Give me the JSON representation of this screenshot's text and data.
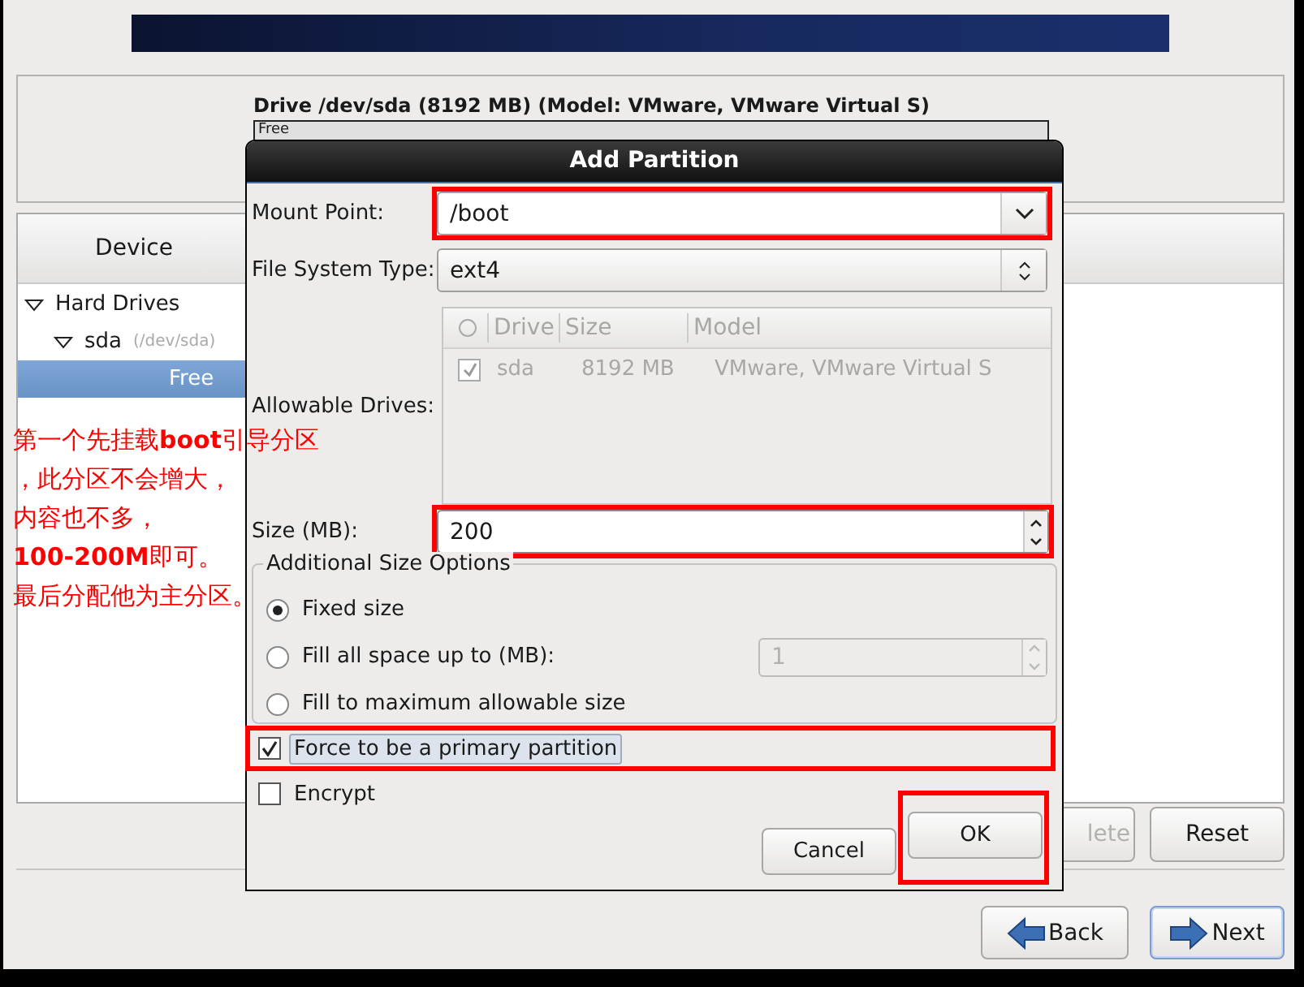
{
  "drive_panel": {
    "title": "Drive /dev/sda (8192 MB) (Model: VMware, VMware Virtual S)",
    "bar_segments": [
      {
        "label": "Free"
      }
    ]
  },
  "device_list": {
    "columns": [
      "Device"
    ],
    "tree": [
      {
        "label": "Hard Drives",
        "expanded": true,
        "selected": false,
        "children": [
          {
            "label": "sda",
            "detail": "(/dev/sda)",
            "expanded": true,
            "selected": false,
            "children": [
              {
                "label": "Free",
                "selected": true
              }
            ]
          }
        ]
      }
    ]
  },
  "panel_buttons": [
    {
      "label": "lete",
      "disabled": true
    },
    {
      "label": "Reset",
      "disabled": false
    }
  ],
  "nav_buttons": [
    {
      "label": "Back",
      "kind": "back",
      "default": false
    },
    {
      "label": "Next",
      "kind": "next",
      "default": true
    }
  ],
  "dialog": {
    "title": "Add Partition",
    "mount_point": {
      "label": "Mount Point:",
      "value": "/boot",
      "highlighted": true
    },
    "file_system_type": {
      "label": "File System Type:",
      "value": "ext4"
    },
    "allowable_drives": {
      "label": "Allowable Drives:",
      "disabled": true,
      "columns": [
        "Drive",
        "Size",
        "Model"
      ],
      "rows": [
        {
          "checked": true,
          "cells": [
            "sda",
            "8192 MB",
            "VMware, VMware Virtual S"
          ]
        }
      ]
    },
    "size": {
      "label": "Size (MB):",
      "value": "200",
      "highlighted": true
    },
    "size_options": {
      "title": "Additional Size Options",
      "options": [
        {
          "label": "Fixed size",
          "selected": true
        },
        {
          "label": "Fill all space up to (MB):",
          "selected": false,
          "spin_value": "1",
          "spin_disabled": true
        },
        {
          "label": "Fill to maximum allowable size",
          "selected": false
        }
      ]
    },
    "checkboxes": [
      {
        "label": "Force to be a primary partition",
        "checked": true,
        "focused": true,
        "highlighted": true
      },
      {
        "label": "Encrypt",
        "checked": false,
        "focused": false,
        "highlighted": false
      }
    ],
    "buttons": [
      {
        "label": "Cancel",
        "highlighted": false
      },
      {
        "label": "OK",
        "highlighted": true
      }
    ]
  },
  "annotation": {
    "lines": [
      "第一个先挂载**boot**引导分区",
      "，此分区不会增大，",
      "内容也不多，",
      "**100-200M**即可。",
      "最后分配他为主分区。"
    ]
  }
}
